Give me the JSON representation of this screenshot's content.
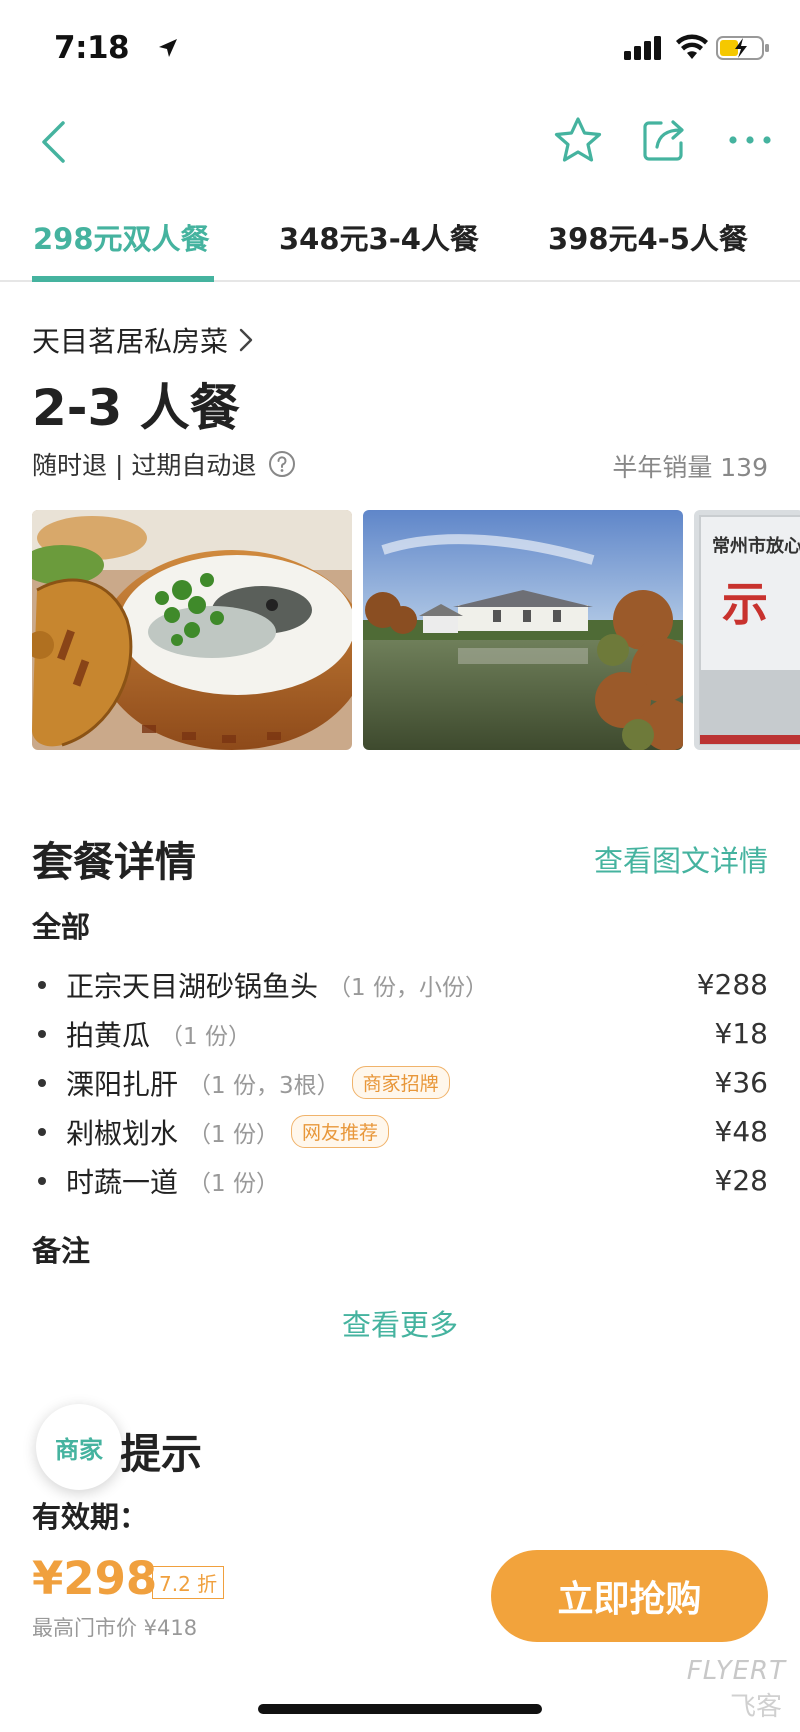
{
  "status_bar": {
    "time": "7:18"
  },
  "nav": {
    "icons": [
      "back-icon",
      "star-icon",
      "share-icon",
      "more-icon"
    ],
    "accent": "#45b39f"
  },
  "tabs": [
    {
      "label": "298元双人餐",
      "active": true
    },
    {
      "label": "348元3-4人餐",
      "active": false
    },
    {
      "label": "398元4-5人餐",
      "active": false
    }
  ],
  "deal": {
    "merchant": "天目茗居私房菜",
    "title": "2-3 人餐",
    "refund_policy": "随时退 | 过期自动退",
    "sales": "半年销量 139",
    "gallery_alt": [
      "fish-head-casserole-photo",
      "restaurant-lake-photo",
      "signboard-photo"
    ],
    "gallery_sign_text": "常州市放心",
    "gallery_sign_char": "示"
  },
  "package": {
    "section_title": "套餐详情",
    "detail_link": "查看图文详情",
    "group_label": "全部",
    "items": [
      {
        "name": "正宗天目湖砂锅鱼头",
        "qty": "（1 份，小份）",
        "tag": "",
        "price": "¥288"
      },
      {
        "name": "拍黄瓜",
        "qty": "（1 份）",
        "tag": "",
        "price": "¥18"
      },
      {
        "name": "溧阳扎肝",
        "qty": "（1 份，3根）",
        "tag": "商家招牌",
        "price": "¥36"
      },
      {
        "name": "剁椒划水",
        "qty": "（1 份）",
        "tag": "网友推荐",
        "price": "¥48"
      },
      {
        "name": "时蔬一道",
        "qty": "（1 份）",
        "tag": "",
        "price": "¥28"
      }
    ],
    "notes_label": "备注",
    "more_link": "查看更多"
  },
  "tips": {
    "title": "提示",
    "merchant_fab": "商家",
    "valid_label": "有效期："
  },
  "purchase": {
    "price": "¥298",
    "discount": "7.2 折",
    "original_price": "最高门市价 ¥418",
    "buy_label": "立即抢购",
    "button_color": "#f2a33c"
  },
  "watermark": {
    "en": "FLYERT",
    "cn": "飞客"
  }
}
